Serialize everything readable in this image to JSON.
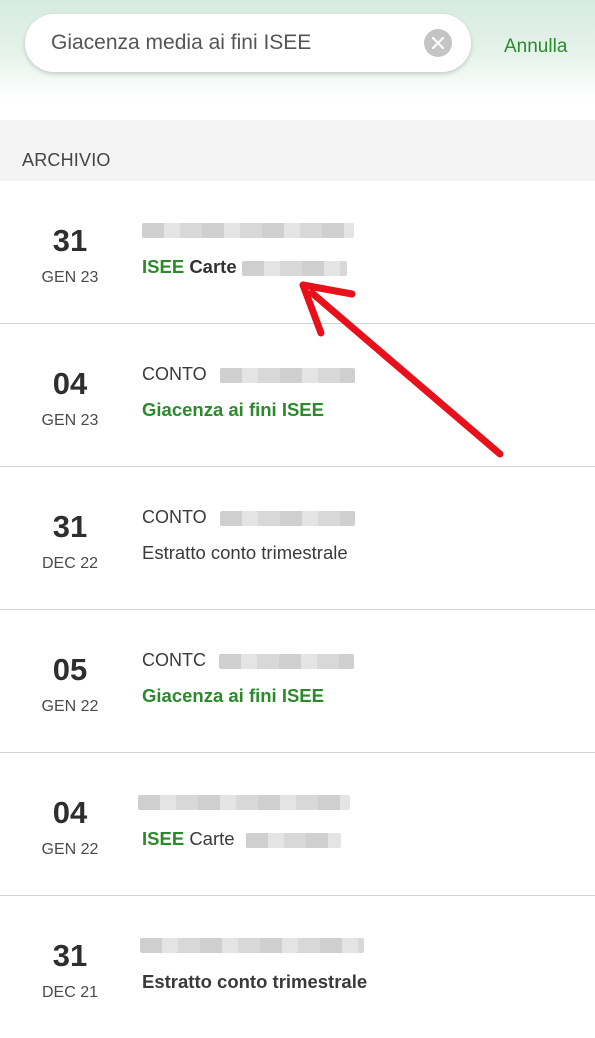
{
  "search": {
    "value": "Giacenza media ai fini ISEE",
    "placeholder": "",
    "cancel_label": "Annulla"
  },
  "section": {
    "title": "ARCHIVIO"
  },
  "colors": {
    "accent": "#2c8a2c",
    "annotation_arrow": "#e8101a"
  },
  "rows": [
    {
      "day": "31",
      "month": "GEN 23",
      "line1": "",
      "line2_highlight": "ISEE",
      "line2_rest": "Carte",
      "bold": true
    },
    {
      "day": "04",
      "month": "GEN 23",
      "line1": "CONTO",
      "line2_highlight": "Giacenza ai fini ISEE",
      "line2_rest": ""
    },
    {
      "day": "31",
      "month": "DEC 22",
      "line1": "CONTO",
      "line2_plain": "Estratto conto trimestrale"
    },
    {
      "day": "05",
      "month": "GEN 22",
      "line1": "CONTC",
      "line2_highlight": "Giacenza ai fini ISEE",
      "line2_rest": ""
    },
    {
      "day": "04",
      "month": "GEN 22",
      "line1": "",
      "line2_highlight": "ISEE",
      "line2_rest": "Carte"
    },
    {
      "day": "31",
      "month": "DEC 21",
      "line1": "",
      "line2_plain_bold": "Estratto conto trimestrale"
    }
  ]
}
